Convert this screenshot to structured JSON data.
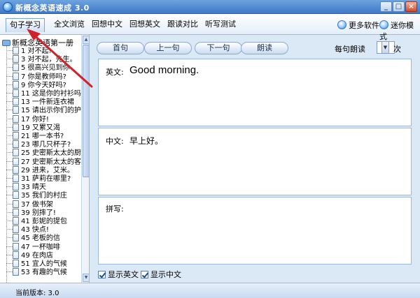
{
  "window": {
    "title": "新概念英语速成 3.0",
    "minimize": "_",
    "maximize": "□",
    "close": "×"
  },
  "nav": {
    "tabs": [
      "句子学习",
      "全文浏览",
      "回想中文",
      "回想英文",
      "跟读对比",
      "听写测试"
    ],
    "more_software": "更多软件",
    "mini_mode": "迷你模式"
  },
  "tree": {
    "root": "新概念英语第一册",
    "items": [
      "1 对不起!",
      "3 对不起，先生。",
      "5 很高兴见到你",
      "7 你是教师吗?",
      "9 你今天好吗?",
      "11 这是你的衬衫吗",
      "13 一件新连衣裙",
      "15 请出示你们的护",
      "17 你好!",
      "19 又累又渴",
      "21 哪一本书?",
      "23 哪几只杯子?",
      "25 史密斯太太的厨",
      "27 史密斯太太的客",
      "29 进来，艾米。",
      "31 萨莉在哪里?",
      "33 晴天",
      "35 我们的村庄",
      "37 做书架",
      "39 别摔了!",
      "41 彭妮的提包",
      "43 快点!",
      "45 老板的信",
      "47 一杯咖啡",
      "49 在肉店",
      "51 宜人的气候",
      "53 有趣的气候"
    ]
  },
  "toolbar": {
    "first": "首句",
    "prev": "上一句",
    "next": "下一句",
    "read": "朗读",
    "read_times_label": "每句朗读",
    "read_times_value": "1",
    "read_times_unit": "次"
  },
  "panels": {
    "english_label": "英文:",
    "english_text": "Good morning.",
    "chinese_label": "中文:",
    "chinese_text": "早上好。",
    "dictation_label": "拼写:"
  },
  "options": {
    "show_english": "显示英文",
    "show_chinese": "显示中文"
  },
  "status": {
    "version": "当前版本: 3.0"
  },
  "colors": {
    "accent": "#3f78c8",
    "annotation": "#d0222a"
  }
}
